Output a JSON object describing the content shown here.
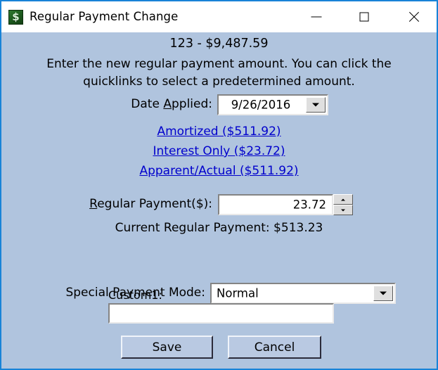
{
  "window": {
    "title": "Regular Payment Change",
    "icon": "dollar-app-icon",
    "border_color": "#1883d7",
    "client_background": "#b0c4de",
    "controls": {
      "minimize": "minimize-icon",
      "maximize": "maximize-icon",
      "close": "close-icon"
    }
  },
  "header": {
    "account_line": "123 - $9,487.59",
    "description_line1": "Enter the new regular payment amount.  You can click the",
    "description_line2": "quicklinks to select a predetermined amount."
  },
  "date_applied": {
    "label_before": "Date ",
    "label_accel": "A",
    "label_after": "pplied:",
    "value": "9/26/2016",
    "dropdown_icon": "chevron-down-icon"
  },
  "quicklinks": [
    {
      "label": "Amortized ($511.92)"
    },
    {
      "label": "Interest Only ($23.72)"
    },
    {
      "label": "Apparent/Actual ($511.92)"
    }
  ],
  "quicklink_color": "#0000cc",
  "regular_payment": {
    "label_accel": "R",
    "label_after": "egular Payment($):",
    "value": "23.72",
    "spin_up_icon": "triangle-up-icon",
    "spin_down_icon": "triangle-down-icon"
  },
  "current_payment": {
    "text": "Current Regular Payment: $513.23"
  },
  "special_payment_mode": {
    "label": "Special Payment Mode:",
    "value": "Normal",
    "dropdown_icon": "chevron-down-icon"
  },
  "custom1": {
    "label": "Custom1:",
    "value": "",
    "placeholder": ""
  },
  "buttons": {
    "save": "Save",
    "cancel": "Cancel"
  }
}
